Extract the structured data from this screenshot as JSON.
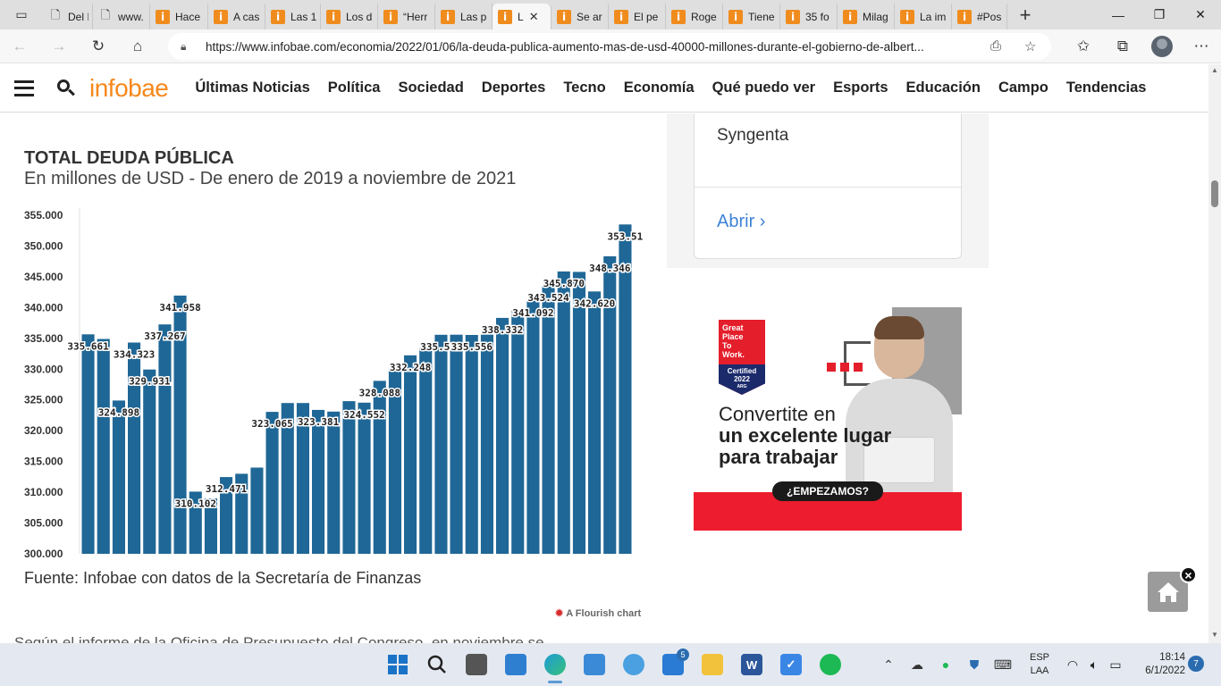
{
  "browser": {
    "tabs": [
      {
        "title": "Del Ir",
        "icon": "document-icon"
      },
      {
        "title": "www.",
        "icon": "document-icon"
      },
      {
        "title": "Hace",
        "icon": "infobae-icon"
      },
      {
        "title": "A cas",
        "icon": "infobae-icon"
      },
      {
        "title": "Las 1",
        "icon": "infobae-icon"
      },
      {
        "title": "Los d",
        "icon": "infobae-icon"
      },
      {
        "title": "“Herr",
        "icon": "infobae-icon"
      },
      {
        "title": "Las p",
        "icon": "infobae-icon"
      },
      {
        "title": "L",
        "icon": "infobae-icon",
        "active": true
      },
      {
        "title": "Se ar",
        "icon": "infobae-icon"
      },
      {
        "title": "El pe",
        "icon": "infobae-icon"
      },
      {
        "title": "Roge",
        "icon": "infobae-icon"
      },
      {
        "title": "Tiene",
        "icon": "infobae-icon"
      },
      {
        "title": "35 fo",
        "icon": "infobae-icon"
      },
      {
        "title": "Milag",
        "icon": "infobae-icon"
      },
      {
        "title": "La im",
        "icon": "infobae-icon"
      },
      {
        "title": "#Pos",
        "icon": "infobae-icon"
      }
    ],
    "url": "https://www.infobae.com/economia/2022/01/06/la-deuda-publica-aumento-mas-de-usd-40000-millones-durante-el-gobierno-de-albert..."
  },
  "site": {
    "logo": "infobae",
    "nav": [
      "Últimas Noticias",
      "Política",
      "Sociedad",
      "Deportes",
      "Tecno",
      "Economía",
      "Qué puedo ver",
      "Esports",
      "Educación",
      "Campo",
      "Tendencias"
    ]
  },
  "chart_meta": {
    "title": "TOTAL DEUDA PÚBLICA",
    "subtitle": "En millones de USD - De enero de 2019 a noviembre de 2021",
    "source": "Fuente: Infobae con datos de la Secretaría de Finanzas",
    "credit": "A Flourish chart"
  },
  "chart_data": {
    "type": "bar",
    "title": "TOTAL DEUDA PÚBLICA",
    "subtitle": "En millones de USD - De enero de 2019 a noviembre de 2021",
    "ylim": [
      300000,
      355000
    ],
    "yticks": [
      "300.000",
      "305.000",
      "310.000",
      "315.000",
      "320.000",
      "325.000",
      "330.000",
      "335.000",
      "340.000",
      "345.000",
      "350.000",
      "355.000"
    ],
    "grid": false,
    "color": "#1f6796",
    "values": [
      335661,
      334900,
      324898,
      334323,
      329931,
      337267,
      341958,
      310102,
      309000,
      312471,
      313000,
      314000,
      323065,
      324500,
      324500,
      323381,
      323100,
      324800,
      324552,
      328088,
      330000,
      332248,
      333500,
      335582,
      335600,
      335556,
      335600,
      338332,
      339500,
      341092,
      343524,
      345870,
      345800,
      342620,
      348346,
      353510
    ],
    "labels": [
      "335.661",
      "",
      "324.898",
      "334.323",
      "329.931",
      "337.267",
      "341.958",
      "310.102",
      "",
      "312.471",
      "",
      "",
      "323.065",
      "",
      "",
      "323.381",
      "",
      "",
      "324.552",
      "328.088",
      "",
      "332.248",
      "",
      "335.582",
      "",
      "335.556",
      "",
      "338.332",
      "",
      "341.092",
      "343.524",
      "345.870",
      "",
      "342.620",
      "348.346",
      "353.51"
    ]
  },
  "aside": {
    "company": "Syngenta",
    "open_label": "Abrir"
  },
  "ad": {
    "badge_line1": "Great",
    "badge_line2": "Place",
    "badge_line3": "To",
    "badge_line4": "Work.",
    "badge_cert": "Certified",
    "badge_year": "2022",
    "badge_country": "ARG",
    "headline_line1": "Convertite en",
    "headline_line2": "un excelente lugar",
    "headline_line3": "para trabajar",
    "cta": "¿EMPEZAMOS?"
  },
  "article": {
    "cut_text": "Según el informe de la Oficina de Presupuesto del Congreso, en noviembre se"
  },
  "taskbar": {
    "mail_badge": "5",
    "lang_line1": "ESP",
    "lang_line2": "LAA",
    "time": "18:14",
    "date": "6/1/2022",
    "notifications": "7"
  }
}
